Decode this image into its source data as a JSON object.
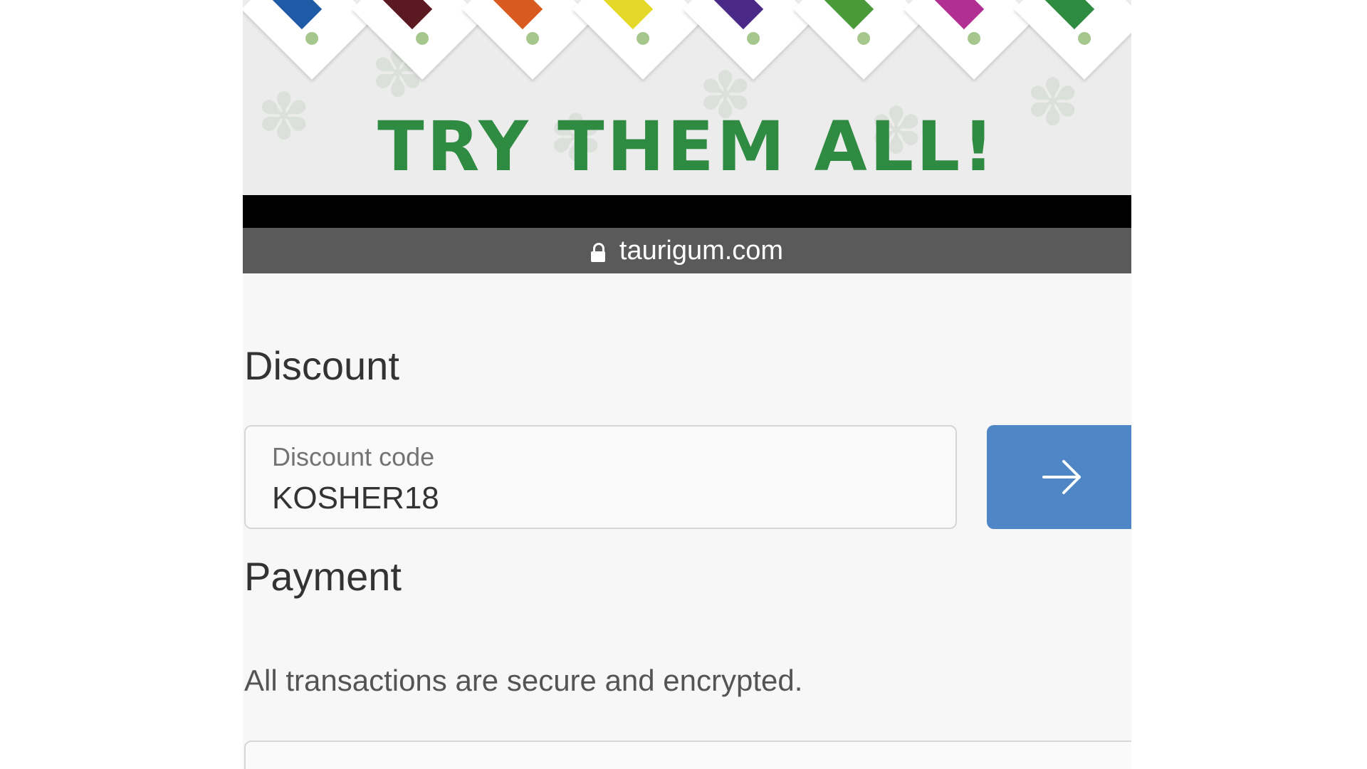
{
  "banner": {
    "headline": "TRY THEM ALL!",
    "headline_color": "#2f8a42"
  },
  "browser": {
    "url": "taurigum.com",
    "lock_icon": "lock-icon"
  },
  "discount": {
    "heading": "Discount",
    "field_label": "Discount code",
    "field_value": "KOSHER18",
    "apply_icon": "arrow-right-icon",
    "button_color": "#4f86c6"
  },
  "payment": {
    "heading": "Payment",
    "note": "All transactions are secure and encrypted."
  }
}
